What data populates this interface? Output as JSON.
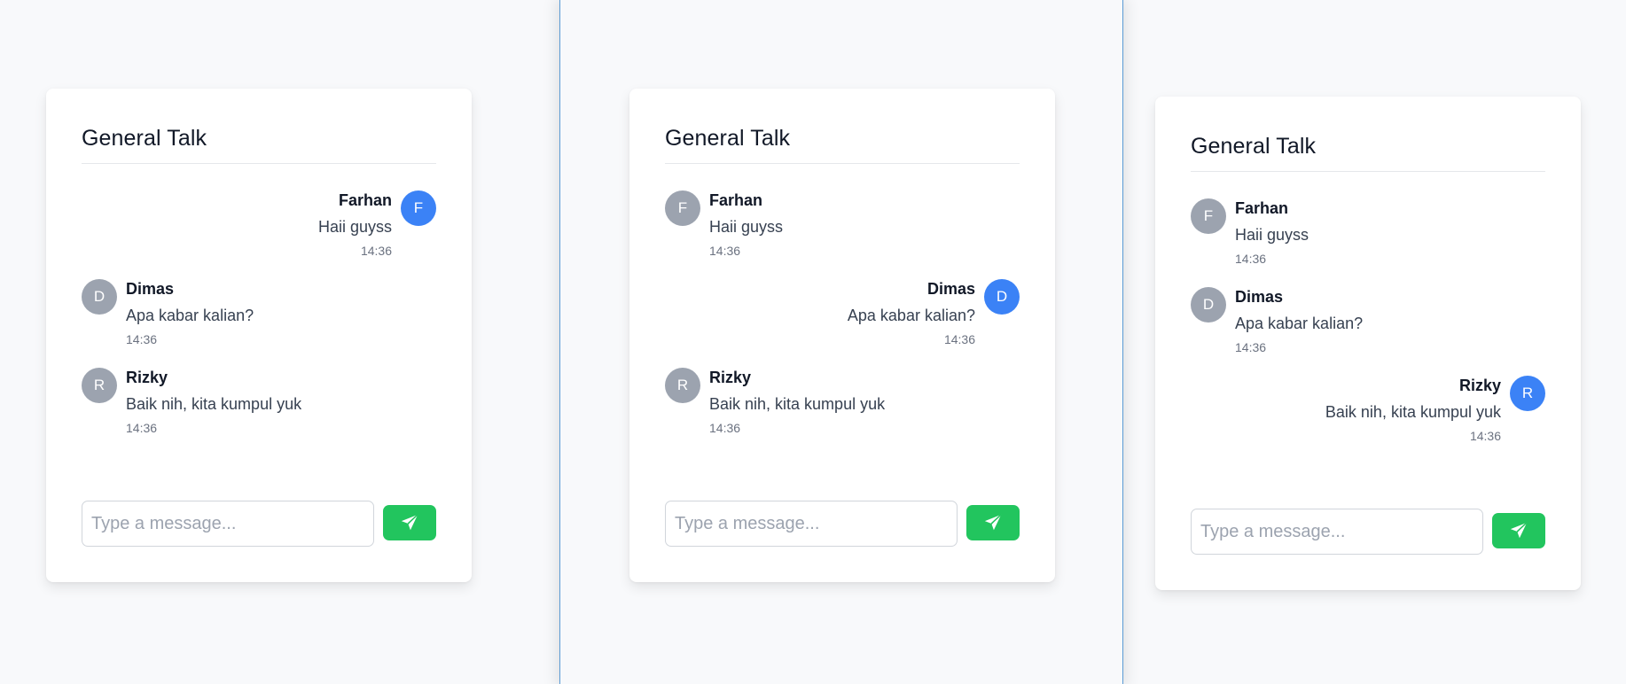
{
  "panels": [
    {
      "title": "General Talk",
      "messages": [
        {
          "name": "Farhan",
          "initial": "F",
          "text": "Haii guyss",
          "time": "14:36",
          "side": "right"
        },
        {
          "name": "Dimas",
          "initial": "D",
          "text": "Apa kabar kalian?",
          "time": "14:36",
          "side": "left"
        },
        {
          "name": "Rizky",
          "initial": "R",
          "text": "Baik nih, kita kumpul yuk",
          "time": "14:36",
          "side": "left"
        }
      ],
      "input_placeholder": "Type a message..."
    },
    {
      "title": "General Talk",
      "messages": [
        {
          "name": "Farhan",
          "initial": "F",
          "text": "Haii guyss",
          "time": "14:36",
          "side": "left"
        },
        {
          "name": "Dimas",
          "initial": "D",
          "text": "Apa kabar kalian?",
          "time": "14:36",
          "side": "right"
        },
        {
          "name": "Rizky",
          "initial": "R",
          "text": "Baik nih, kita kumpul yuk",
          "time": "14:36",
          "side": "left"
        }
      ],
      "input_placeholder": "Type a message..."
    },
    {
      "title": "General Talk",
      "messages": [
        {
          "name": "Farhan",
          "initial": "F",
          "text": "Haii guyss",
          "time": "14:36",
          "side": "left"
        },
        {
          "name": "Dimas",
          "initial": "D",
          "text": "Apa kabar kalian?",
          "time": "14:36",
          "side": "left"
        },
        {
          "name": "Rizky",
          "initial": "R",
          "text": "Baik nih, kita kumpul yuk",
          "time": "14:36",
          "side": "right"
        }
      ],
      "input_placeholder": "Type a message..."
    }
  ],
  "icons": {
    "send": "paper-plane-icon"
  },
  "colors": {
    "own_avatar": "#3b82f6",
    "other_avatar": "#9ca3af",
    "send_button": "#22c55e",
    "frame_border": "#5a9bd5"
  }
}
